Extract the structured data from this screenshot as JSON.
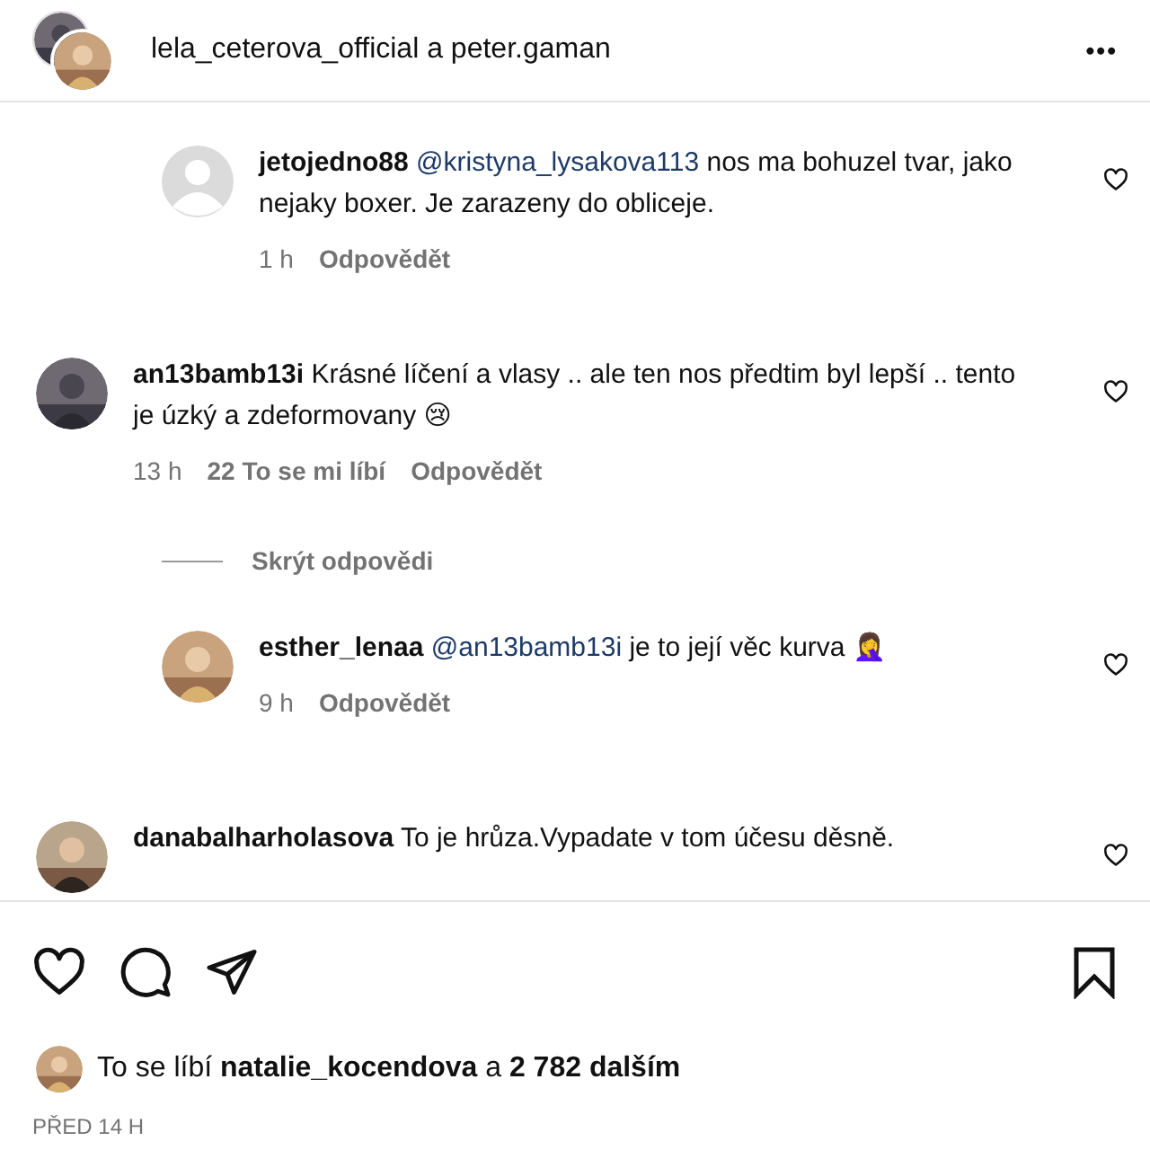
{
  "header": {
    "title": "lela_ceterova_official a peter.gaman",
    "more": "•••"
  },
  "comments": [
    {
      "kind": "reply",
      "user": "jetojedno88",
      "mention": "@kristyna_lysakova113",
      "text": "nos ma bohuzel tvar, jako nejaky boxer. Je zarazeny do obliceje.",
      "time": "1 h",
      "reply_label": "Odpovědět",
      "photo": false
    },
    {
      "kind": "comment",
      "user": "an13bamb13i",
      "text": "Krásné líčení a vlasy .. ale ten nos předtim byl lepší .. tento je úzký a zdeformovany 😢",
      "time": "13 h",
      "likes": "22 To se mi líbí",
      "reply_label": "Odpovědět",
      "photo": true
    },
    {
      "kind": "toggle",
      "text": "Skrýt odpovědi"
    },
    {
      "kind": "reply",
      "user": "esther_lenaa",
      "mention": "@an13bamb13i",
      "text": "je to její věc kurva 🤦‍♀️",
      "time": "9 h",
      "reply_label": "Odpovědět",
      "photo": true
    },
    {
      "kind": "comment",
      "user": "danabalharholasova",
      "text": "To je hrůza.Vypadate v tom účesu děsně.",
      "photo": true
    }
  ],
  "likes": {
    "text": "To se líbí **natalie_kocendova** a **2 782 dalším**"
  },
  "posted": "PŘED 14 H"
}
